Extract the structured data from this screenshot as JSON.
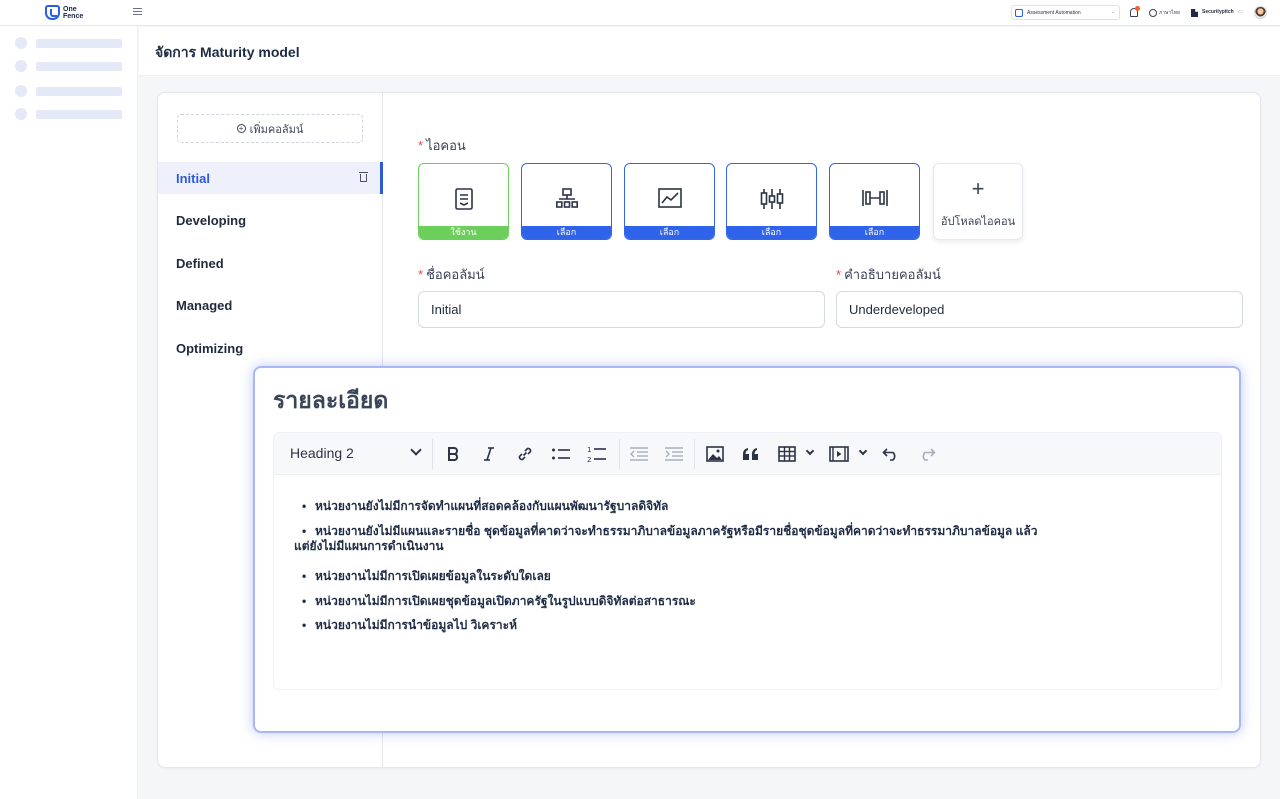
{
  "app": {
    "logo_line1": "One",
    "logo_line2": "Fence"
  },
  "topbar": {
    "assessment_select": "Assessment Automation",
    "language": "ภาษาไทย",
    "org_name": "Securitypitch"
  },
  "page": {
    "title": "จัดการ Maturity model"
  },
  "columns_panel": {
    "add_button": "เพิ่มคอลัมน์",
    "items": [
      {
        "label": "Initial",
        "active": true
      },
      {
        "label": "Developing",
        "active": false
      },
      {
        "label": "Defined",
        "active": false
      },
      {
        "label": "Managed",
        "active": false
      },
      {
        "label": "Optimizing",
        "active": false
      }
    ]
  },
  "form": {
    "icon_label": "ไอคอน",
    "icons": [
      {
        "name": "document-icon",
        "status": "ใช้งาน"
      },
      {
        "name": "hierarchy-icon",
        "status": "เลือก"
      },
      {
        "name": "line-chart-icon",
        "status": "เลือก"
      },
      {
        "name": "candlestick-icon",
        "status": "เลือก"
      },
      {
        "name": "dumbbell-icon",
        "status": "เลือก"
      }
    ],
    "upload_icon_label": "อัปโหลดไอคอน",
    "column_name_label": "ชื่อคอลัมน์",
    "column_name_value": "Initial",
    "column_desc_label": "คำอธิบายคอลัมน์",
    "column_desc_value": "Underdeveloped"
  },
  "detail": {
    "title": "รายละเอียด",
    "heading_select": "Heading 2",
    "bullets": [
      "หน่วยงานยังไม่มีการจัดทำแผนที่สอดคล้องกับแผนพัฒนารัฐบาลดิจิทัล",
      "หน่วยงานยังไม่มีแผนและรายชื่อ ชุดข้อมูลที่คาดว่าจะทำธรรมาภิบาลข้อมูลภาครัฐหรือมีรายชื่อชุดข้อมูลที่คาดว่าจะทำธรรมาภิบาลข้อมูล แล้ว",
      "แต่ยังไม่มีแผนการดำเนินงาน",
      "หน่วยงานไม่มีการเปิดเผยข้อมูลในระดับใดเลย",
      "หน่วยงานไม่มีการเปิดเผยชุดข้อมูลเปิดภาครัฐในรูปแบบดิจิทัลต่อสาธารณะ",
      "หน่วยงานไม่มีการนำข้อมูลไป วิเคราะห์"
    ]
  },
  "colors": {
    "primary": "#2f63ea",
    "active_green": "#6ccf5b",
    "required": "#e5484d"
  }
}
